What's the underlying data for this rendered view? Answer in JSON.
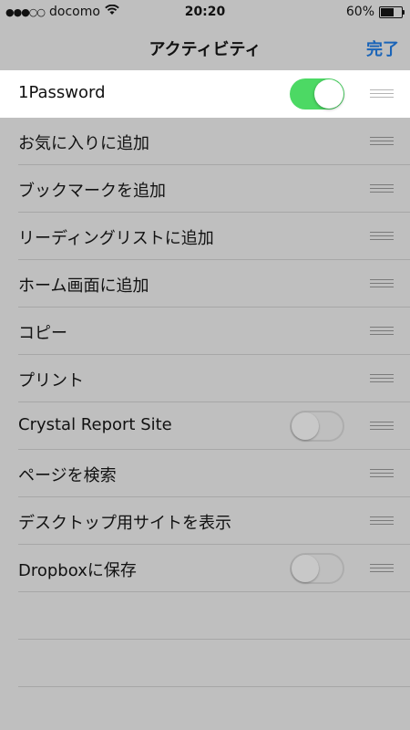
{
  "status_bar": {
    "signal": "●●●○○",
    "carrier": "docomo",
    "wifi_icon": "wifi-icon",
    "time": "20:20",
    "battery": "60%",
    "battery_level": 0.6
  },
  "navbar": {
    "title": "アクティビティ",
    "done_label": "完了"
  },
  "rows": [
    {
      "label": "1Password",
      "toggle": "on"
    },
    {
      "label": "お気に入りに追加"
    },
    {
      "label": "ブックマークを追加"
    },
    {
      "label": "リーディングリストに追加"
    },
    {
      "label": "ホーム画面に追加"
    },
    {
      "label": "コピー"
    },
    {
      "label": "プリント"
    },
    {
      "label": "Crystal Report Site",
      "toggle": "off"
    },
    {
      "label": "ページを検索"
    },
    {
      "label": "デスクトップ用サイトを表示"
    },
    {
      "label": "Dropboxに保存",
      "toggle": "off"
    }
  ],
  "colors": {
    "accent": "#1a64b8",
    "toggle_on": "#4cd964",
    "overlay_bg": "#bfbfbf"
  }
}
